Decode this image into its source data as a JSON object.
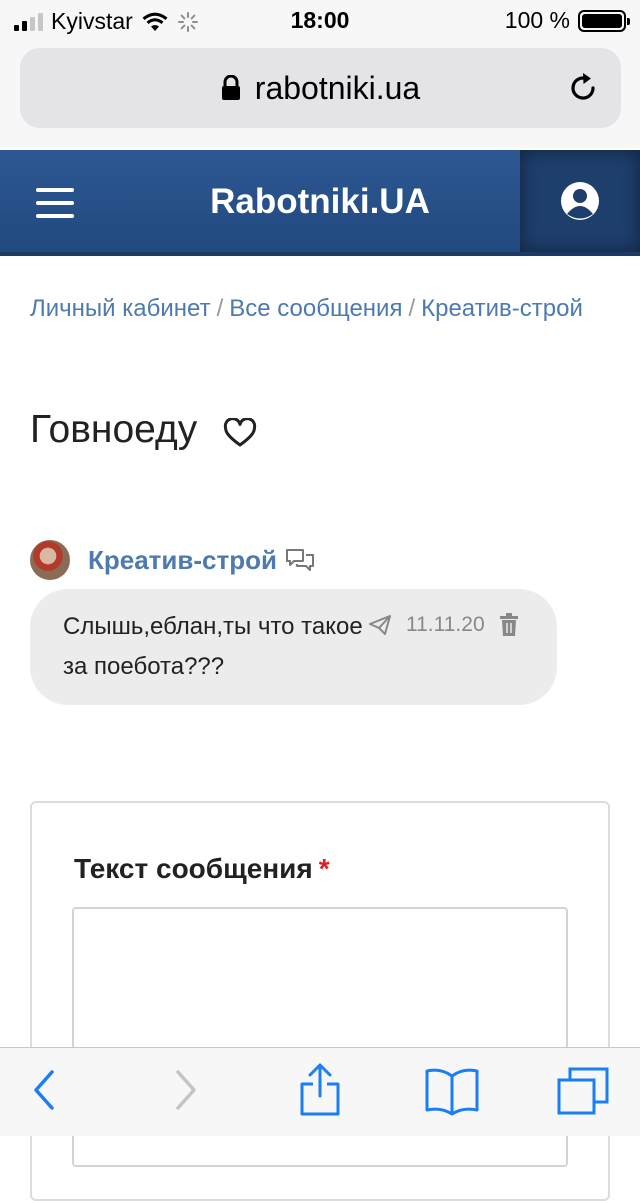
{
  "status_bar": {
    "carrier": "Kyivstar",
    "time": "18:00",
    "battery": "100 %",
    "battery_level": 1.0
  },
  "browser": {
    "url": "rabotniki.ua"
  },
  "site": {
    "brand": "Rabotniki.UA"
  },
  "breadcrumb": {
    "items": [
      "Личный кабинет",
      "Все сообщения",
      "Креатив-строй"
    ],
    "separator": "/"
  },
  "page": {
    "title": "Говноеду"
  },
  "message": {
    "author": "Креатив-строй",
    "text": "Слышь,еблан,ты что такое за поебота???",
    "date": "11.11.20"
  },
  "form": {
    "label": "Текст сообщения",
    "required_mark": "*",
    "textarea_value": ""
  },
  "colors": {
    "header_blue": "#2d5893",
    "link_blue": "#4d7ab0",
    "ios_blue": "#1a7ef5",
    "required_red": "#e02020"
  },
  "toolbar": {
    "icons": [
      "back-icon",
      "forward-icon",
      "share-icon",
      "bookmarks-icon",
      "tabs-icon"
    ]
  }
}
